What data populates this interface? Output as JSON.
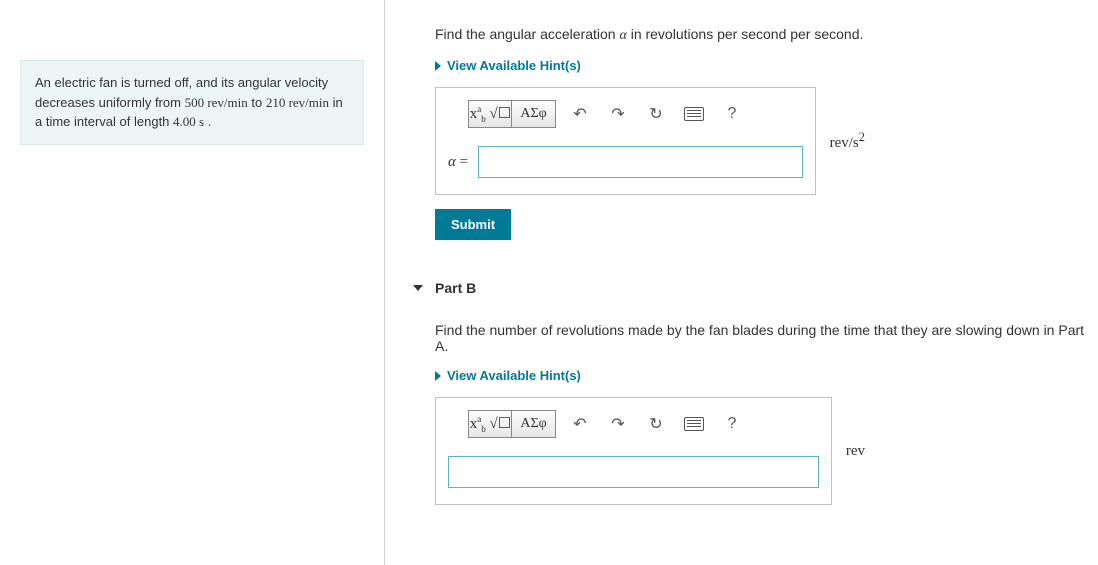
{
  "problem": {
    "text_before": "An electric fan is turned off, and its angular velocity decreases uniformly from ",
    "val1": "500 rev/min",
    "text_mid1": " to ",
    "val2": "210 rev/min",
    "text_mid2": " in a time interval of length ",
    "val3": "4.00 s",
    "text_after": " ."
  },
  "partA": {
    "prompt_before": "Find the angular acceleration ",
    "prompt_var": "α",
    "prompt_after": " in revolutions per second per second.",
    "hints_label": "View Available Hint(s)",
    "var_eq": "α =",
    "unit_html": "rev/s²",
    "submit": "Submit",
    "toolbar": {
      "templates": "▮√☐",
      "greek": "ΑΣφ",
      "undo": "↶",
      "redo": "↷",
      "reset": "↻",
      "keyboard": "⌨",
      "help": "?"
    }
  },
  "partB": {
    "title": "Part B",
    "prompt": "Find the number of revolutions made by the fan blades during the time that they are slowing down in Part A.",
    "hints_label": "View Available Hint(s)",
    "unit": "rev",
    "toolbar": {
      "templates": "▮√☐",
      "greek": "ΑΣφ",
      "undo": "↶",
      "redo": "↷",
      "reset": "↻",
      "keyboard": "⌨",
      "help": "?"
    }
  }
}
